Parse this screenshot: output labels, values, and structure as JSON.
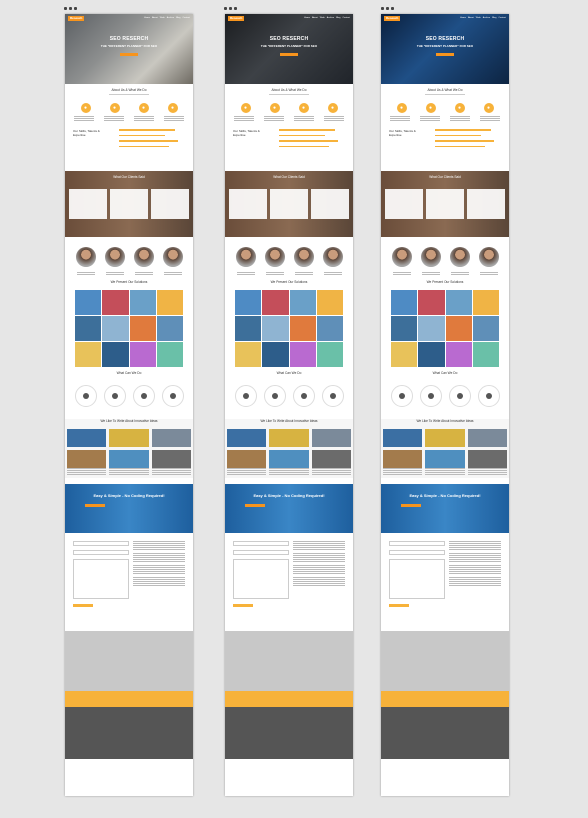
{
  "colors": {
    "accent": "#f7941d",
    "accent_light": "#f7b23a",
    "cta_blue": "#2f76b7",
    "footer": "#555555"
  },
  "columns": [
    {
      "variant": "v0",
      "logo": "Reseach",
      "nav": [
        "Home",
        "About",
        "Work",
        "Archive",
        "Blog",
        "Contact"
      ],
      "hero_title": "SEO RESERCH",
      "hero_sub": "THE \"DIFFERENT PLANNER\" FOR SEO",
      "about_title": "About Us & What We Do",
      "skills_title": "Our Skills, Talents & Expertise",
      "testimonials_title": "What Our Clients Said",
      "solutions_title": "We Present Our Solutions",
      "whatwedo_title": "What Can We Do",
      "blog_title": "We Like To Write About Innovative Ideas",
      "cta_title": "Easy & Simple - No Coding Required!"
    },
    {
      "variant": "v1",
      "logo": "Reseach",
      "nav": [
        "Home",
        "About",
        "Work",
        "Archive",
        "Blog",
        "Contact"
      ],
      "hero_title": "SEO RESERCH",
      "hero_sub": "THE \"DIFFERENT PLANNER\" FOR SEO",
      "about_title": "About Us & What We Do",
      "skills_title": "Our Skills, Talents & Expertise",
      "testimonials_title": "What Our Clients Said",
      "solutions_title": "We Present Our Solutions",
      "whatwedo_title": "What Can We Do",
      "blog_title": "We Like To Write About Innovative Ideas",
      "cta_title": "Easy & Simple - No Coding Required!"
    },
    {
      "variant": "v2",
      "logo": "Reseach",
      "nav": [
        "Home",
        "About",
        "Work",
        "Archive",
        "Blog",
        "Contact"
      ],
      "hero_title": "SEO RESERCH",
      "hero_sub": "THE \"DIFFERENT PLANNER\" FOR SEO",
      "about_title": "About Us & What We Do",
      "skills_title": "Our Skills, Talents & Expertise",
      "testimonials_title": "What Our Clients Said",
      "solutions_title": "We Present Our Solutions",
      "whatwedo_title": "What Can We Do",
      "blog_title": "We Like To Write About Innovative Ideas",
      "cta_title": "Easy & Simple - No Coding Required!"
    }
  ]
}
